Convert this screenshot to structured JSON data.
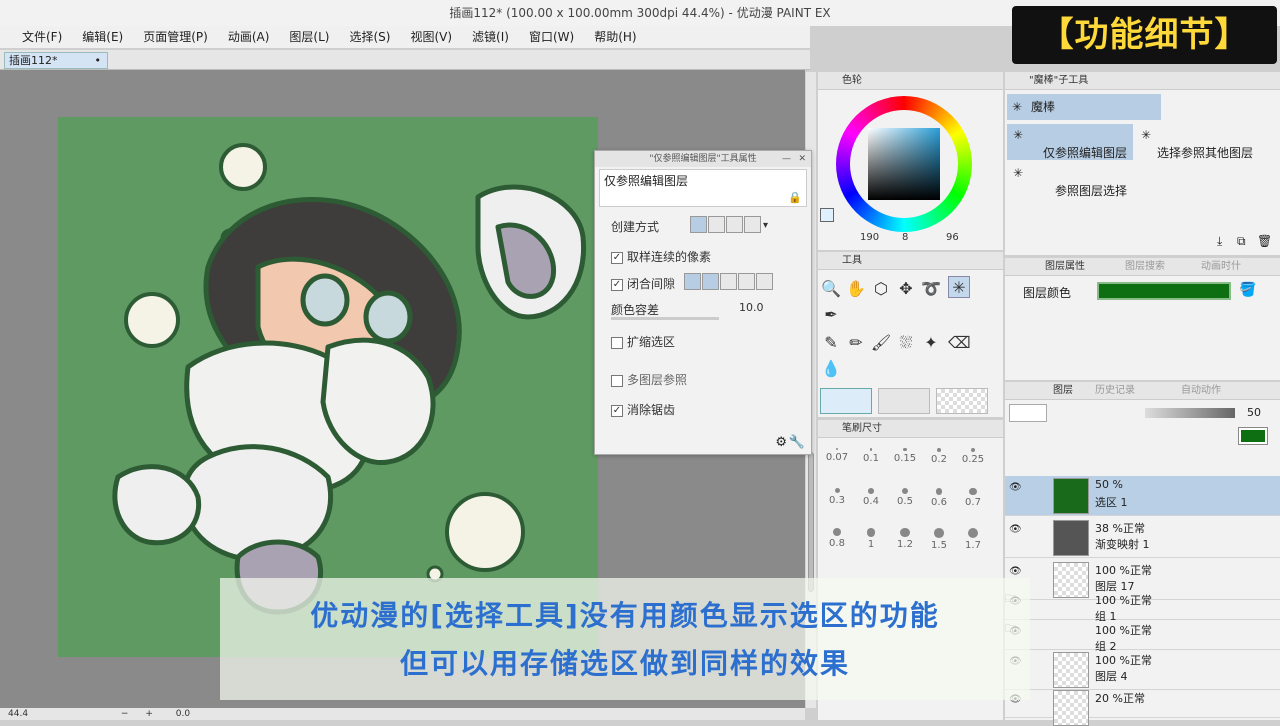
{
  "window": {
    "title": "插画112* (100.00 x 100.00mm 300dpi 44.4%) - 优动漫 PAINT EX"
  },
  "menu": [
    "文件(F)",
    "编辑(E)",
    "页面管理(P)",
    "动画(A)",
    "图层(L)",
    "选择(S)",
    "视图(V)",
    "滤镜(I)",
    "窗口(W)",
    "帮助(H)"
  ],
  "doc_tab": {
    "label": "插画112*"
  },
  "status": {
    "zoom": "44.4",
    "angle": "0.0"
  },
  "tool_property": {
    "header": "\"仅参照编辑图层\"工具属性",
    "name": "仅参照编辑图层",
    "create_mode_label": "创建方式",
    "sample_contiguous": {
      "label": "取样连续的像素",
      "checked": true
    },
    "close_gap": {
      "label": "闭合间隙",
      "checked": true
    },
    "color_tolerance": {
      "label": "颜色容差",
      "value": "10.0"
    },
    "expand_selection": {
      "label": "扩缩选区",
      "checked": false
    },
    "multi_layer_ref": {
      "label": "多图层参照",
      "checked": false
    },
    "antialias": {
      "label": "消除锯齿",
      "checked": true
    }
  },
  "color_panel": {
    "title": "色轮",
    "h": "190",
    "s": "8",
    "v": "96",
    "main_color": "#1c1c1c",
    "sub_color": "#ffffff"
  },
  "tool_panel": {
    "title": "工具",
    "active": "magic-wand"
  },
  "brush_size": {
    "title": "笔刷尺寸",
    "sizes": [
      "0.07",
      "0.1",
      "0.15",
      "0.2",
      "0.25",
      "0.3",
      "0.4",
      "0.5",
      "0.6",
      "0.7",
      "0.8",
      "1",
      "1.2",
      "1.5",
      "1.7"
    ]
  },
  "subtool": {
    "header": "\"魔棒\"子工具",
    "group": "魔棒",
    "items": [
      "仅参照编辑图层",
      "选择参照其他图层",
      "参照图层选择"
    ],
    "selected": "仅参照编辑图层"
  },
  "layer_property": {
    "tabs": [
      "图层属性",
      "图层搜索",
      "动画时什"
    ],
    "layer_color_label": "图层颜色",
    "layer_color": "#0e6e12"
  },
  "layers": {
    "tabs": [
      "图层",
      "历史记录",
      "自动动作"
    ],
    "opacity": "50",
    "items": [
      {
        "mode": "50 %",
        "name": "选区 1"
      },
      {
        "mode": "38 %正常",
        "name": "渐变映射 1"
      },
      {
        "mode": "100 %正常",
        "name": "图层 17"
      },
      {
        "mode": "100 %正常",
        "name": "组 1"
      },
      {
        "mode": "100 %正常",
        "name": "组 2"
      },
      {
        "mode": "100 %正常",
        "name": "图层 4"
      },
      {
        "mode": "20 %正常",
        "name": ""
      }
    ]
  },
  "caption": {
    "line1": "优动漫的[选择工具]没有用颜色显示选区的功能",
    "line2": "但可以用存储选区做到同样的效果"
  },
  "badge": "【功能细节】",
  "colors": {
    "canvas_bg": "#5f9a63",
    "accent": "#2c6fce",
    "badge_text": "#ffd83a"
  }
}
